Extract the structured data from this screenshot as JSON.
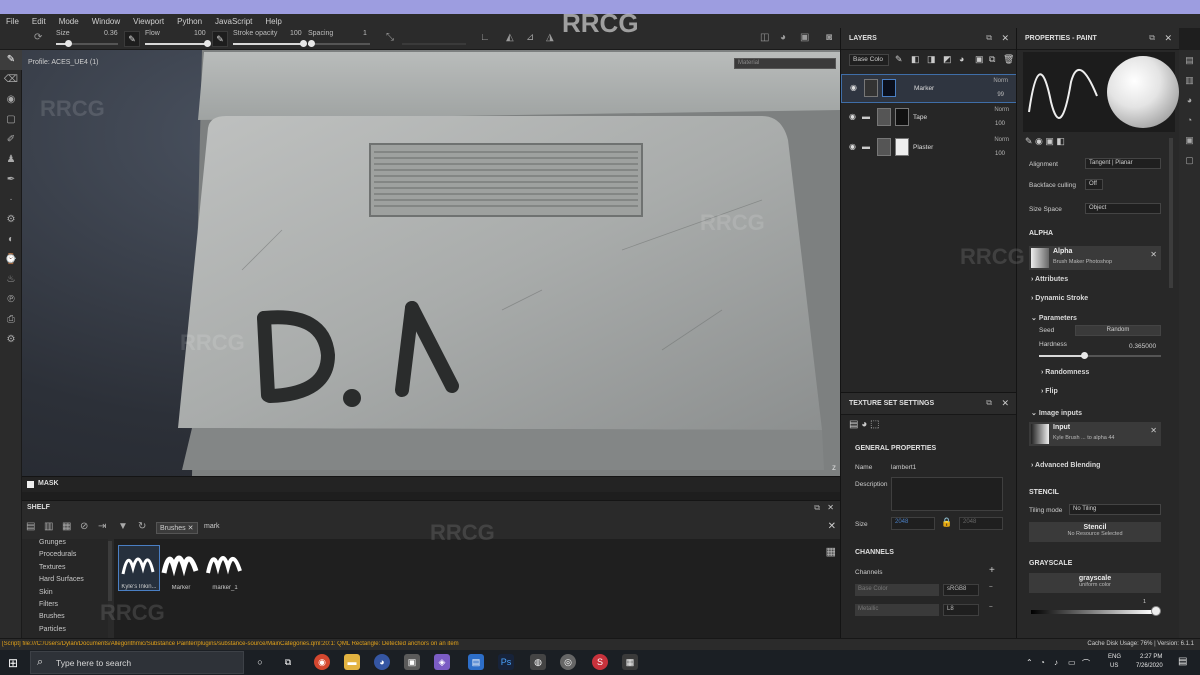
{
  "menu": [
    "File",
    "Edit",
    "Mode",
    "Window",
    "Viewport",
    "Python",
    "JavaScript",
    "Help"
  ],
  "toolbar": {
    "size_label": "Size",
    "size_value": "0.36",
    "size_level": 0.2,
    "flow_label": "Flow",
    "flow_value": "100",
    "flow_level": 1.0,
    "stroke_opacity_label": "Stroke opacity",
    "stroke_opacity_value": "100",
    "stroke_opacity_level": 1.0,
    "spacing_label": "Spacing",
    "spacing_value": "1",
    "spacing_level": 0.05
  },
  "viewport": {
    "profile": "Profile: ACES_UE4 (1)",
    "material_select": "Material",
    "axis": "z"
  },
  "mask": {
    "label": "MASK"
  },
  "shelf": {
    "title": "SHELF",
    "filter_tag": "Brushes",
    "search_value": "mark",
    "categories": [
      "Grunges",
      "Procedurals",
      "Textures",
      "Hard Surfaces",
      "Skin",
      "Filters",
      "Brushes",
      "Particles"
    ],
    "brushes": [
      {
        "label": "Kyle's Inkin..."
      },
      {
        "label": "Marker"
      },
      {
        "label": "marker_1"
      }
    ]
  },
  "layers": {
    "title": "LAYERS",
    "blend_select": "Base Colo",
    "rows": [
      {
        "name": "Marker",
        "blend": "Norm",
        "opacity": "99"
      },
      {
        "name": "Tape",
        "blend": "Norm",
        "opacity": "100"
      },
      {
        "name": "Plaster",
        "blend": "Norm",
        "opacity": "100"
      }
    ]
  },
  "tss": {
    "title": "TEXTURE SET SETTINGS",
    "general": "GENERAL PROPERTIES",
    "name_label": "Name",
    "name_value": "lambert1",
    "desc_label": "Description",
    "size_label": "Size",
    "size_value": "2048",
    "size_value2": "2048",
    "channels_title": "CHANNELS",
    "channels_label": "Channels",
    "channels": [
      {
        "name": "Base Color",
        "format": "sRGB8"
      },
      {
        "name": "Metallic",
        "format": "L8"
      }
    ]
  },
  "props": {
    "title": "PROPERTIES - PAINT",
    "alignment_label": "Alignment",
    "alignment_value": "Tangent | Planar",
    "backface_label": "Backface culling",
    "backface_value": "Off",
    "sizespace_label": "Size Space",
    "sizespace_value": "Object",
    "alpha_section": "ALPHA",
    "alpha_name": "Alpha",
    "alpha_sub": "Brush Maker Photoshop",
    "attributes": "Attributes",
    "dynamic_stroke": "Dynamic Stroke",
    "parameters": "Parameters",
    "seed_label": "Seed",
    "seed_value": "Random",
    "hardness_label": "Hardness",
    "hardness_value": "0.365000",
    "hardness_level": 0.365,
    "randomness": "Randomness",
    "flip": "Flip",
    "image_inputs": "Image inputs",
    "input_name": "Input",
    "input_sub": "Kyle Brush ... to alpha 44",
    "advanced_blending": "Advanced Blending",
    "stencil_section": "STENCIL",
    "tiling_label": "Tiling mode",
    "tiling_value": "No Tiling",
    "stencil_btn": "Stencil",
    "stencil_sub": "No Resource Selected",
    "grayscale_section": "GRAYSCALE",
    "grayscale_btn": "grayscale",
    "grayscale_sub": "uniform color",
    "grayscale_value": "1"
  },
  "status": {
    "log": "[Script] file:///C:/Users/Dylan/Documents/Allegorithmic/Substance Painter/plugins/substance-source/MainCategories.qml:20:1: QML Rectangle: Detected anchors on an item",
    "right": "Cache Disk Usage:   76%  |  Version: 6.1.1"
  },
  "taskbar": {
    "search_placeholder": "Type here to search",
    "lang": "ENG",
    "region": "US",
    "time": "2:27 PM",
    "date": "7/26/2020"
  },
  "watermark": "RRCG",
  "colors": {
    "accent": "#4a7fc4",
    "log": "#e3a21a",
    "topstrip": "#9d9de0"
  }
}
